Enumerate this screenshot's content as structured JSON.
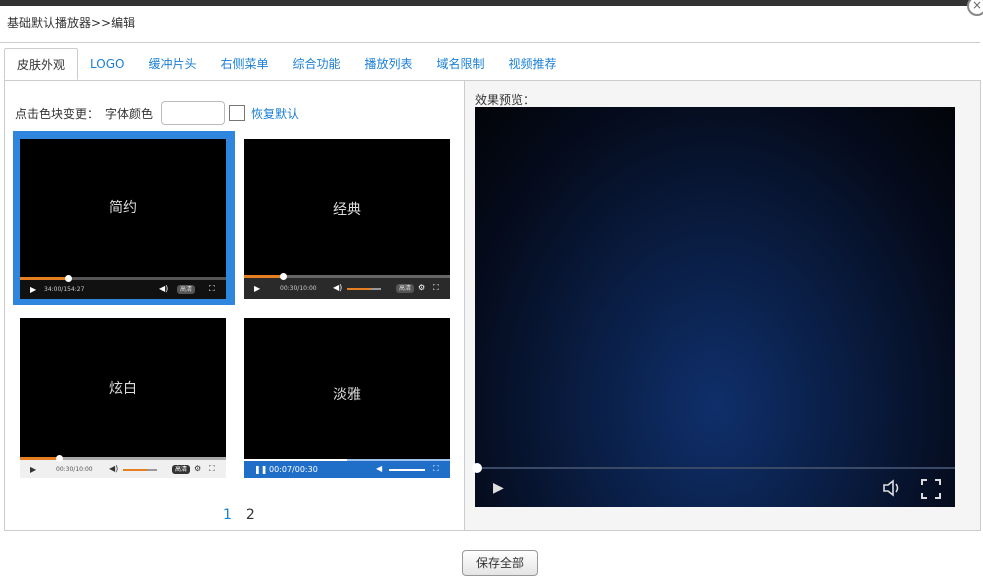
{
  "window": {
    "close": "×"
  },
  "breadcrumb": "基础默认播放器>>编辑",
  "tabs": [
    "皮肤外观",
    "LOGO",
    "缓冲片头",
    "右侧菜单",
    "综合功能",
    "播放列表",
    "域名限制",
    "视频推荐"
  ],
  "active_tab": 0,
  "skin_panel": {
    "hint": "点击色块变更：",
    "font_color_label": "字体颜色",
    "font_color_value": "",
    "reset_label": "恢复默认"
  },
  "skins": [
    {
      "name": "简约",
      "time": "34:00/154:27",
      "quality": "高清",
      "progress": 0.23,
      "selected": true
    },
    {
      "name": "经典",
      "time": "00:30/10:00",
      "quality": "高清",
      "progress": 0.19,
      "selected": false
    },
    {
      "name": "炫白",
      "time": "00:30/10:00",
      "quality": "高清",
      "progress": 0.19,
      "selected": false
    },
    {
      "name": "淡雅",
      "time": "00:07/00:30",
      "quality": "",
      "progress": 0.5,
      "selected": false
    }
  ],
  "pagination": {
    "pages": [
      "1",
      "2"
    ],
    "current": "1"
  },
  "preview": {
    "label": "效果预览："
  },
  "footer": {
    "save_label": "保存全部"
  },
  "colors": {
    "accent": "#1a7fd4",
    "selected_border": "#2e86de",
    "progress": "#e67e22",
    "blue_bar": "#1f6fc9"
  }
}
